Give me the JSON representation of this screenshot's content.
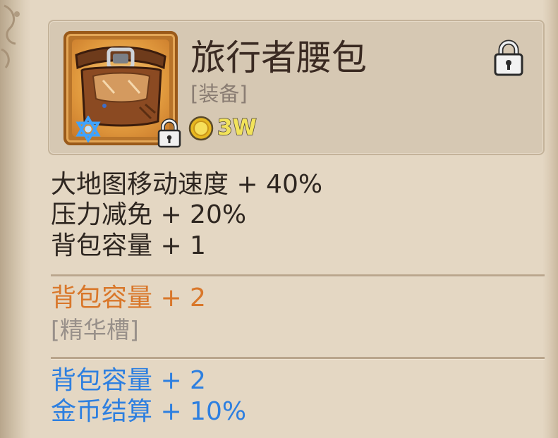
{
  "item": {
    "name": "旅行者腰包",
    "type": "[装备]",
    "price": "3W",
    "icon": "belt-bag-icon",
    "rarity_icon": "star-of-david-icon",
    "locked": true
  },
  "base_stats": [
    "大地图移动速度 + 40%",
    "压力减免 + 20%",
    "背包容量 + 1"
  ],
  "essence_section": {
    "stat": "背包容量 + 2",
    "slot_label": "[精华槽]"
  },
  "bonus_stats": [
    "背包容量 + 2",
    "金币结算 + 10%"
  ],
  "colors": {
    "base": "#2e2620",
    "essence": "#d9772a",
    "slot": "#98908a",
    "bonus": "#2d7fe0",
    "price": "#f2e35b"
  }
}
